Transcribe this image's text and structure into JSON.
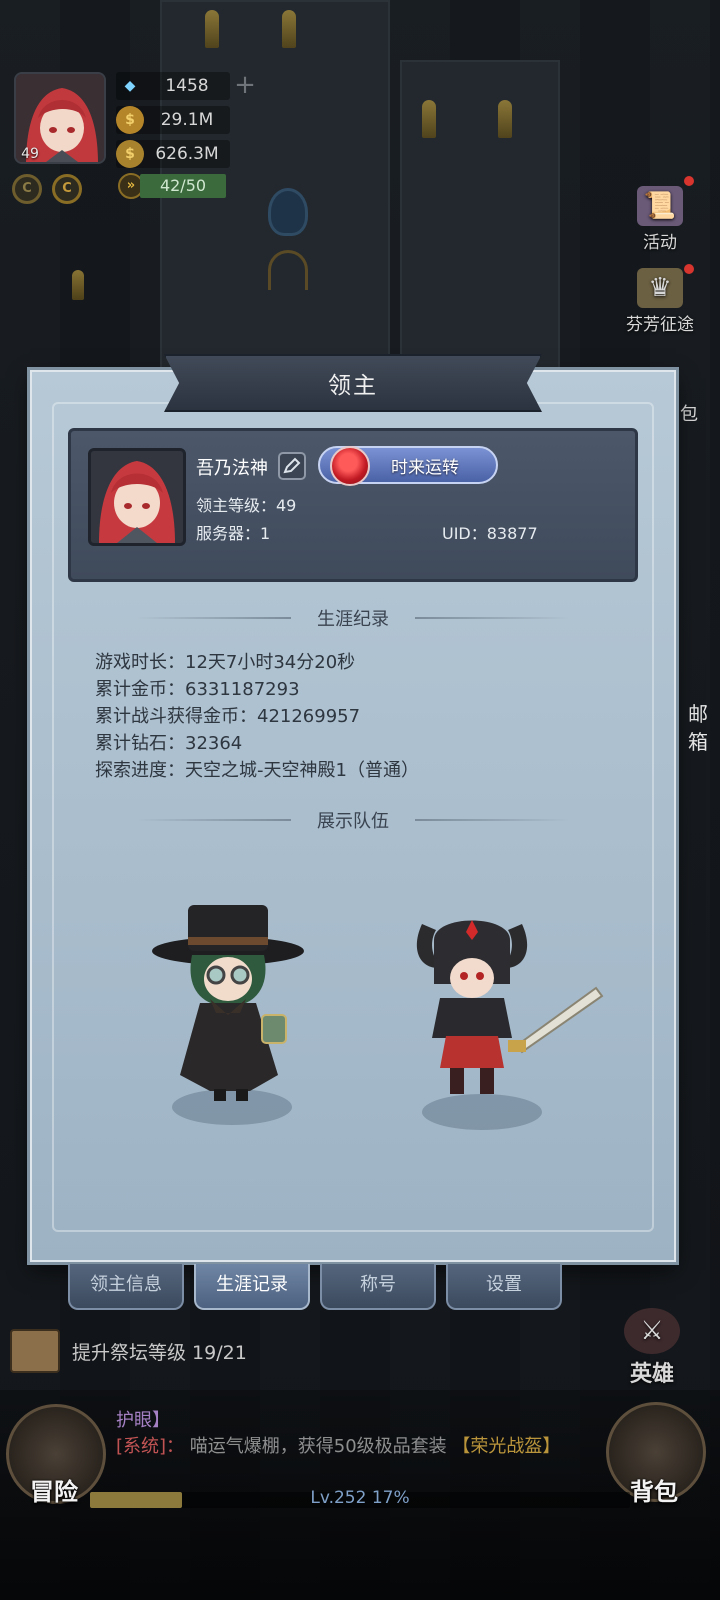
{
  "player": {
    "level": "49",
    "diamonds": "1458",
    "gold": "29.1M",
    "coins": "626.3M",
    "energy": "42/50",
    "exp_progress": 0.17
  },
  "side_menu": {
    "activity": "活动",
    "journey": "芬芳征途",
    "mail": "邮箱",
    "heroes": "英雄",
    "bag": "背包",
    "bag_partial": "包"
  },
  "panel": {
    "title": "领主",
    "lord_name": "吾乃法神",
    "title_badge": "时来运转",
    "lord_level_label": "领主等级：49",
    "server_label": "服务器：1",
    "uid_label": "UID：83877",
    "career_header": "生涯纪录",
    "stats": [
      "游戏时长：12天7小时34分20秒",
      "累计金币：6331187293",
      "累计战斗获得金币：421269957",
      "累计钻石：32364",
      "探索进度：天空之城-天空神殿1（普通）"
    ],
    "team_header": "展示队伍"
  },
  "tabs": [
    "领主信息",
    "生涯记录",
    "称号",
    "设置"
  ],
  "active_tab": "生涯记录",
  "quest": {
    "text": "提升祭坛等级 19/21"
  },
  "chat": {
    "tag1": "护眼】",
    "tag_sys": "[系统]：",
    "message": "喵运气爆棚，获得50级极品套装",
    "item": "【荣光战盔】"
  },
  "adventure_label": "冒险",
  "level_display": "Lv.252   17%",
  "colors": {
    "panel_bg": "#b0c4d2",
    "card_bg": "#4c586a",
    "active_tab": "#6f86a4",
    "energy_bar": "#3b6a3c"
  }
}
